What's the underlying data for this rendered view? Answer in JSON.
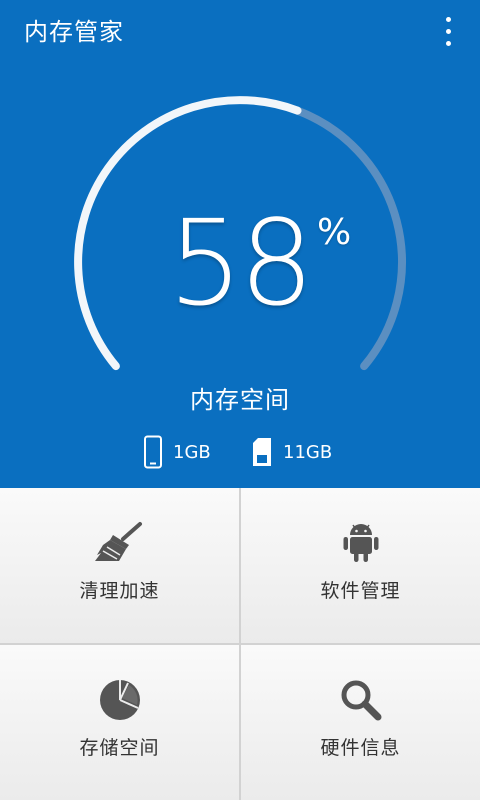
{
  "header": {
    "title": "内存管家",
    "menu_icon": "more-vert-icon"
  },
  "gauge": {
    "percent_value": "58",
    "percent_unit": "%",
    "usage_fraction": 0.58,
    "label": "内存空间",
    "colors": {
      "background": "#0a6fc0",
      "filled": "#f2f6fa",
      "unfilled": "#5b8fc1"
    }
  },
  "storage": {
    "phone": {
      "icon": "phone-icon",
      "value": "1GB"
    },
    "sdcard": {
      "icon": "sd-card-icon",
      "value": "11GB"
    }
  },
  "tiles": [
    {
      "label": "清理加速",
      "icon": "broom-icon"
    },
    {
      "label": "软件管理",
      "icon": "android-icon"
    },
    {
      "label": "存储空间",
      "icon": "pie-chart-icon"
    },
    {
      "label": "硬件信息",
      "icon": "magnifier-icon"
    }
  ],
  "colors": {
    "accent": "#0a6fc0",
    "tile_text": "#333333",
    "icon": "#555555"
  }
}
